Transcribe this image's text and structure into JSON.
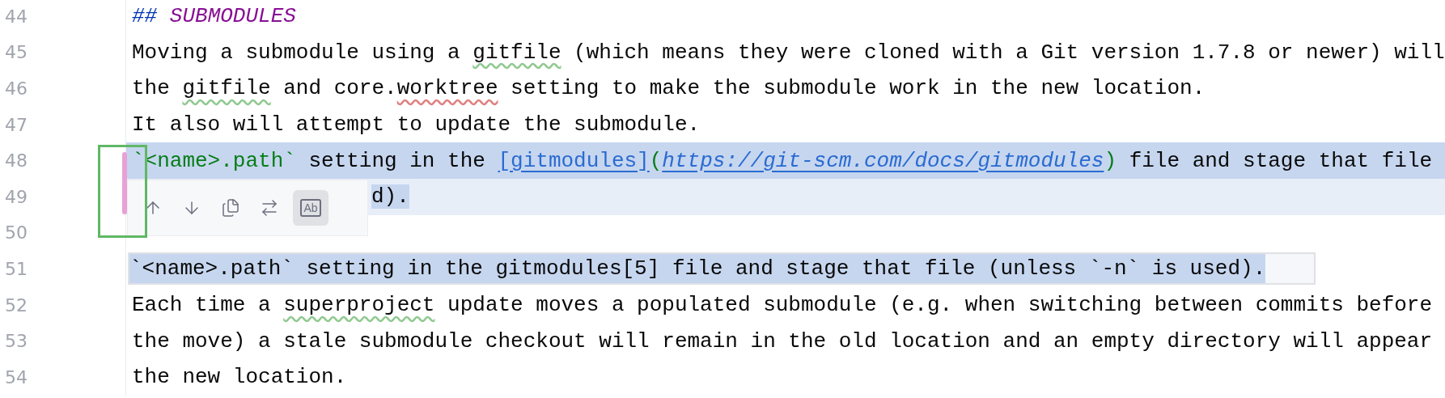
{
  "editor": {
    "lines": [
      {
        "number": "44",
        "selected": false,
        "segments": [
          {
            "kind": "heading-mark",
            "text": "##"
          },
          {
            "kind": "heading",
            "text": " SUBMODULES"
          }
        ]
      },
      {
        "number": "45",
        "selected": false,
        "segments": [
          {
            "kind": "plain",
            "text": "Moving a submodule using a "
          },
          {
            "kind": "weak-warning",
            "text": "gitfile"
          },
          {
            "kind": "plain",
            "text": " (which means they were cloned with a Git version 1.7.8 or newer) will"
          }
        ]
      },
      {
        "number": "46",
        "selected": false,
        "segments": [
          {
            "kind": "plain",
            "text": "the "
          },
          {
            "kind": "weak-warning",
            "text": "gitfile"
          },
          {
            "kind": "plain",
            "text": " and core."
          },
          {
            "kind": "spelling",
            "text": "worktree"
          },
          {
            "kind": "plain",
            "text": " setting to make the submodule work in the new location."
          }
        ]
      },
      {
        "number": "47",
        "selected": false,
        "segments": [
          {
            "kind": "plain",
            "text": "It also will attempt to update the submodule."
          }
        ]
      },
      {
        "number": "48",
        "selected": true,
        "segments": [
          {
            "kind": "code",
            "text": "`<name>.path`"
          },
          {
            "kind": "plain",
            "text": " setting in the "
          },
          {
            "kind": "link-text",
            "text": "[gitmodules]"
          },
          {
            "kind": "paren",
            "text": "("
          },
          {
            "kind": "url",
            "text": "https://git-scm.com/docs/gitmodules"
          },
          {
            "kind": "paren",
            "text": ")"
          },
          {
            "kind": "plain",
            "text": " file and stage that file"
          }
        ]
      },
      {
        "number": "49",
        "selected": true,
        "covered": true,
        "segments": [
          {
            "kind": "plain",
            "text": "d)."
          }
        ]
      },
      {
        "number": "50",
        "selected": false
      },
      {
        "number": "51",
        "selected": true,
        "preview": true,
        "segments": [
          {
            "kind": "plain",
            "text": "`<name>.path` setting in the gitmodules[5] file and stage that file (unless `-n` is used)."
          }
        ]
      },
      {
        "number": "52",
        "selected": false,
        "segments": [
          {
            "kind": "plain",
            "text": "Each time a "
          },
          {
            "kind": "weak-warning",
            "text": "superproject"
          },
          {
            "kind": "plain",
            "text": " update moves a populated submodule (e.g. when switching between commits before"
          }
        ]
      },
      {
        "number": "53",
        "selected": false,
        "segments": [
          {
            "kind": "plain",
            "text": "the move) a stale submodule checkout will remain in the old location and an empty directory will appear"
          }
        ]
      },
      {
        "number": "54",
        "selected": false,
        "segments": [
          {
            "kind": "plain",
            "text": "the new location."
          }
        ]
      }
    ],
    "toolbar": {
      "buttons": [
        {
          "kind": "up"
        },
        {
          "kind": "down"
        },
        {
          "kind": "copy"
        },
        {
          "kind": "merge"
        }
      ],
      "toggle": {
        "label": "Ab",
        "selected": true
      }
    }
  }
}
